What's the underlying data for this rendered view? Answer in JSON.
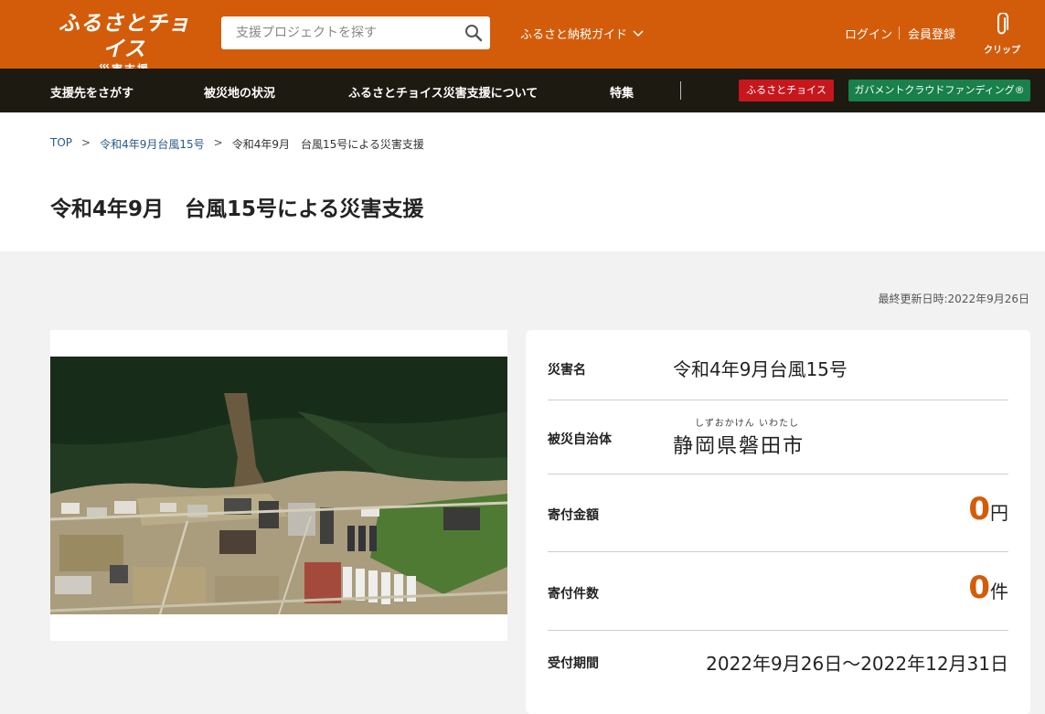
{
  "header": {
    "logo_main": "ふるさとチョイス",
    "logo_sub": "災害支援",
    "search_placeholder": "支援プロジェクトを探す",
    "guide_label": "ふるさと納税ガイド",
    "login_label": "ログイン",
    "register_label": "会員登録",
    "clip_label": "クリップ"
  },
  "nav": {
    "items": [
      "支援先をさがす",
      "被災地の状況",
      "ふるさとチョイス災害支援について",
      "特集"
    ],
    "badge_choice": "ふるさとチョイス",
    "badge_gcf": "ガバメントクラウドファンディング®"
  },
  "breadcrumb": {
    "top": "TOP",
    "sep": ">",
    "level2": "令和4年9月台風15号",
    "current": "令和4年9月　台風15号による災害支援"
  },
  "page_title": "令和4年9月　台風15号による災害支援",
  "updated": "最終更新日時:2022年9月26日",
  "info": {
    "disaster_label": "災害名",
    "disaster_value": "令和4年9月台風15号",
    "municipality_label": "被災自治体",
    "municipality_reading": "しずおかけん いわたし",
    "municipality_value": "静岡県磐田市",
    "amount_label": "寄付金額",
    "amount_value": "0",
    "amount_unit": "円",
    "count_label": "寄付件数",
    "count_value": "0",
    "count_unit": "件",
    "period_label": "受付期間",
    "period_value": "2022年9月26日〜2022年12月31日"
  },
  "colors": {
    "header_bg": "#d35c0a",
    "nav_bg": "#1d1a12",
    "badge_choice": "#c8161d",
    "badge_gcf": "#18804b",
    "accent_number": "#d35c0a"
  }
}
